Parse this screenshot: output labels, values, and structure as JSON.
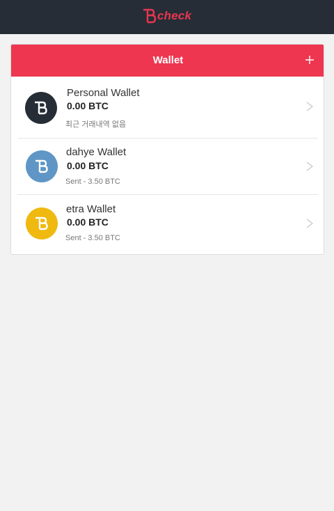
{
  "header": {
    "brand": "check",
    "colors": {
      "bar": "#262d36",
      "brand": "#e8364f"
    }
  },
  "wallet_card": {
    "title": "Wallet",
    "add_icon": "plus-icon",
    "accent": "#ee3650",
    "wallets": [
      {
        "name": "Personal Wallet",
        "amount": "0.00 BTC",
        "status": "최근 거래내역 없음",
        "color": "#262d36",
        "icon": "bytecoin-icon"
      },
      {
        "name": "dahye Wallet",
        "amount": "0.00 BTC",
        "status": "Sent - 3.50 BTC",
        "color": "#5f96c6",
        "icon": "bytecoin-icon"
      },
      {
        "name": "etra Wallet",
        "amount": "0.00 BTC",
        "status": "Sent - 3.50 BTC",
        "color": "#efb910",
        "icon": "bytecoin-icon"
      }
    ]
  }
}
